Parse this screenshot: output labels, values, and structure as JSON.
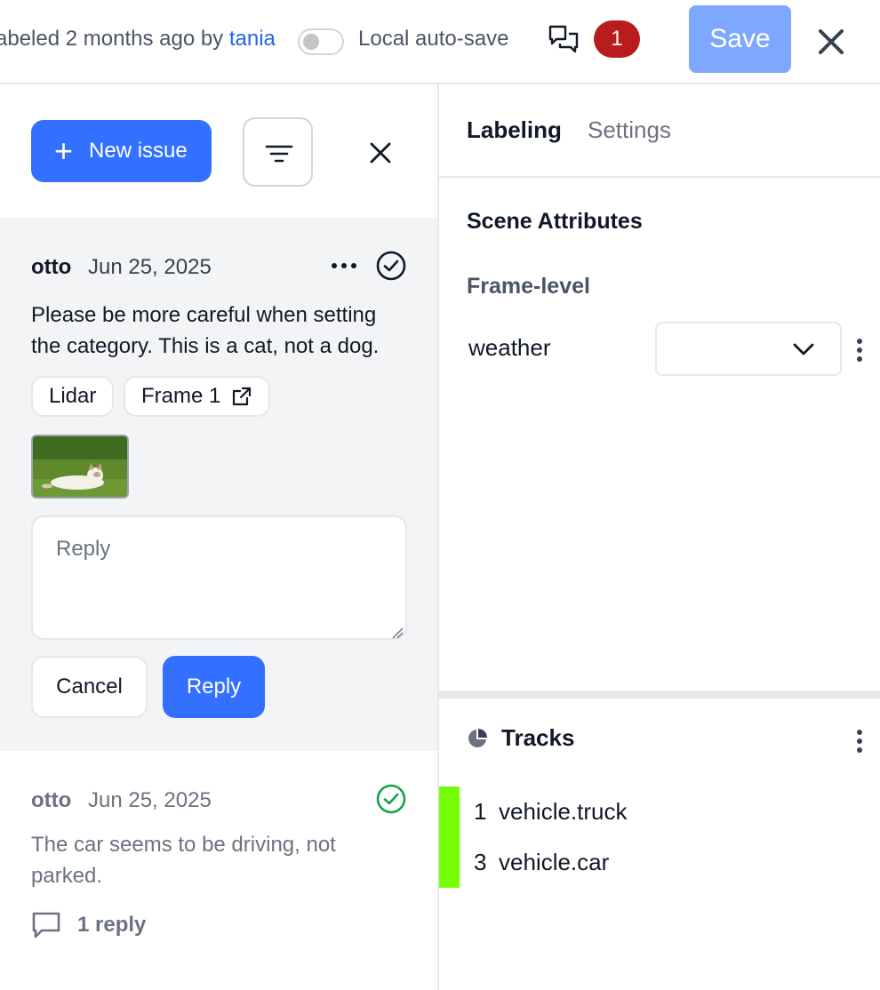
{
  "topbar": {
    "labeled_prefix": "abeled 2 months ago by ",
    "labeled_user": "tania",
    "autosave_label": "Local auto-save",
    "autosave_on": false,
    "issue_count": "1",
    "save_label": "Save",
    "icons": {
      "comments": "comments-icon",
      "close": "close-icon"
    }
  },
  "issues_panel": {
    "new_issue_label": "New issue",
    "icons": {
      "plus": "plus-icon",
      "filter": "filter-icon",
      "close": "close-icon"
    },
    "issues": [
      {
        "author": "otto",
        "date": "Jun 25, 2025",
        "text": "Please be more careful when setting the category. This is a cat, not a dog.",
        "chips": [
          "Lidar",
          "Frame 1"
        ],
        "resolved": false,
        "reply_placeholder": "Reply",
        "cancel_label": "Cancel",
        "reply_label": "Reply"
      },
      {
        "author": "otto",
        "date": "Jun 25, 2025",
        "text": "The car seems to be driving, not parked.",
        "resolved": true,
        "reply_count": "1 reply"
      }
    ]
  },
  "right_panel": {
    "tabs": [
      "Labeling",
      "Settings"
    ],
    "active_tab": "Labeling",
    "scene_title": "Scene Attributes",
    "frame_level": "Frame-level",
    "attribute": {
      "label": "weather",
      "value": ""
    },
    "tracks_title": "Tracks",
    "tracks": [
      {
        "id": "1",
        "name": "vehicle.truck",
        "color": "#76ff03"
      },
      {
        "id": "3",
        "name": "vehicle.car",
        "color": "#76ff03"
      }
    ]
  },
  "colors": {
    "accent": "#3370ff",
    "save_disabled": "#7ea8ff",
    "badge": "#b91c1c",
    "resolved": "#16a34a",
    "link": "#2563eb"
  }
}
